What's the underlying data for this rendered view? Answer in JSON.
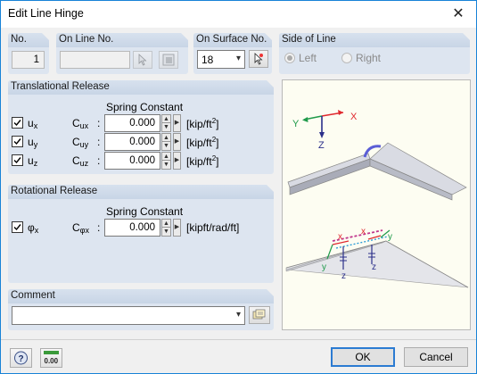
{
  "window": {
    "title": "Edit Line Hinge"
  },
  "no": {
    "label": "No.",
    "value": "1"
  },
  "on_line": {
    "label": "On Line No.",
    "value": ""
  },
  "on_surface": {
    "label": "On Surface No.",
    "value": "18"
  },
  "side": {
    "label": "Side of Line",
    "options": [
      "Left",
      "Right"
    ],
    "selected": "Left"
  },
  "translational": {
    "label": "Translational Release",
    "spring_header": "Spring Constant",
    "rows": [
      {
        "u": "u",
        "u_sub": "x",
        "c": "C",
        "c_sub": "ux",
        "value": "0.000",
        "unit_pre": "[kip/ft",
        "unit_sup": "2",
        "unit_post": "]",
        "checked": true
      },
      {
        "u": "u",
        "u_sub": "y",
        "c": "C",
        "c_sub": "uy",
        "value": "0.000",
        "unit_pre": "[kip/ft",
        "unit_sup": "2",
        "unit_post": "]",
        "checked": true
      },
      {
        "u": "u",
        "u_sub": "z",
        "c": "C",
        "c_sub": "uz",
        "value": "0.000",
        "unit_pre": "[kip/ft",
        "unit_sup": "2",
        "unit_post": "]",
        "checked": true
      }
    ]
  },
  "rotational": {
    "label": "Rotational Release",
    "spring_header": "Spring Constant",
    "row": {
      "u": "φ",
      "u_sub": "x",
      "c": "C",
      "c_sub": "φx",
      "value": "0.000",
      "unit": "[kipft/rad/ft]",
      "checked": true
    }
  },
  "comment": {
    "label": "Comment",
    "value": ""
  },
  "diagram": {
    "axis_x": "X",
    "axis_y": "Y",
    "axis_z": "Z",
    "local_x": "x",
    "local_y": "y",
    "local_z": "z"
  },
  "footer": {
    "ok": "OK",
    "cancel": "Cancel",
    "units_icon_text": "0.00"
  },
  "colors": {
    "accent": "#1883d7",
    "group_bg": "#dde5f0",
    "preview_bg": "#fdfdf2",
    "axis_x": "#e0282e",
    "axis_y": "#1f9a4a",
    "axis_z": "#2b2f8a"
  }
}
